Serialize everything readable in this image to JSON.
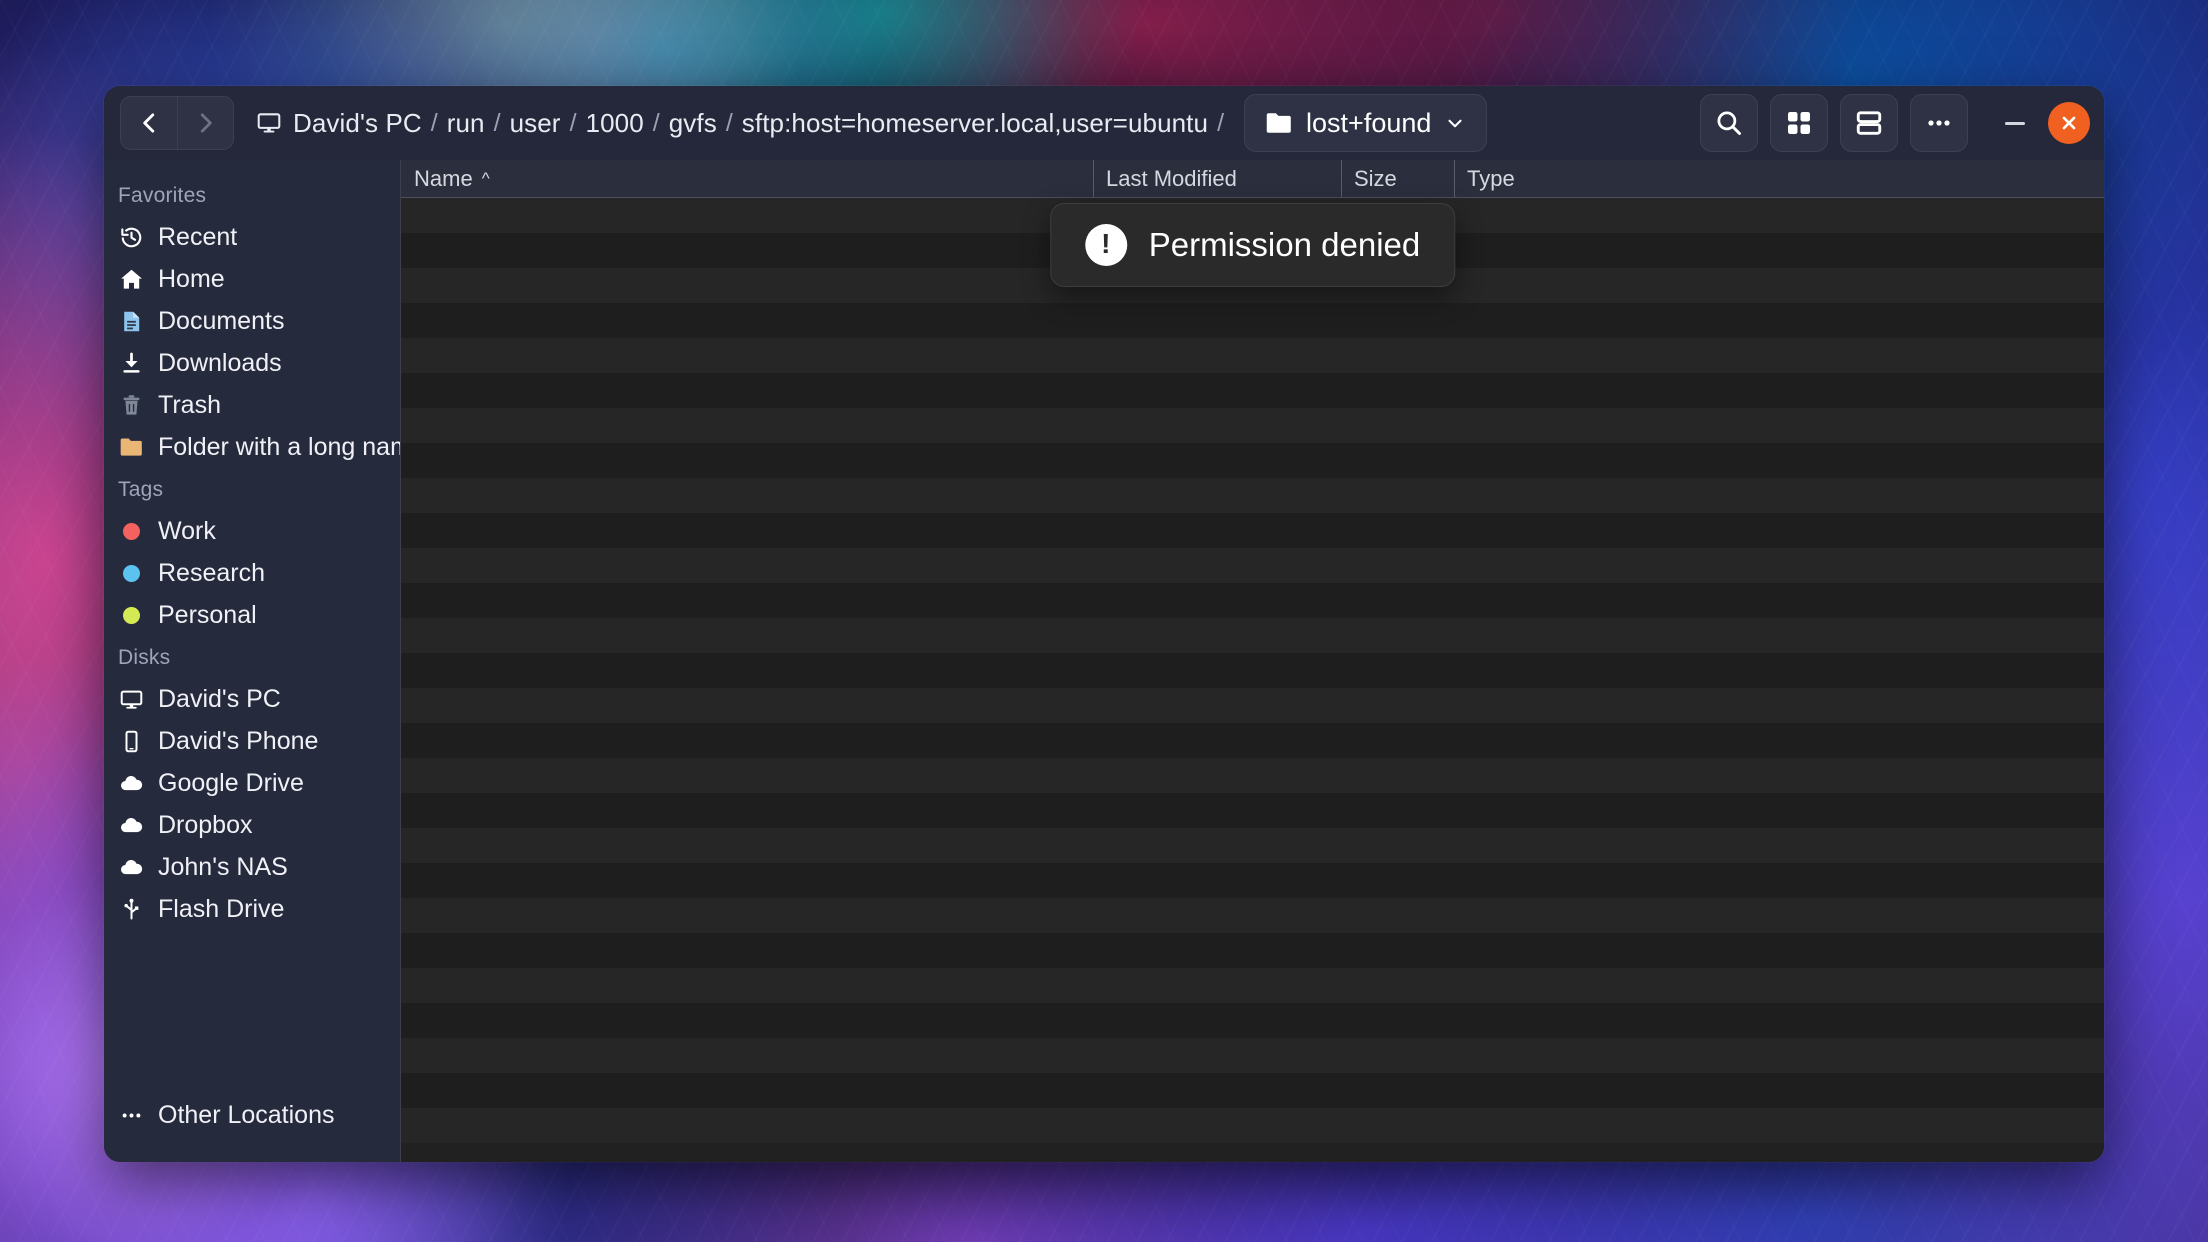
{
  "window": {
    "nav": {
      "back_icon": "chevron-left-icon",
      "forward_icon": "chevron-right-icon"
    },
    "breadcrumb": {
      "root_icon": "monitor-icon",
      "items": [
        "David's PC",
        "run",
        "user",
        "1000",
        "gvfs",
        "sftp:host=homeserver.local,user=ubuntu"
      ],
      "separator": "/"
    },
    "current_folder": {
      "icon": "folder-icon",
      "label": "lost+found",
      "chevron": "chevron-down-icon"
    },
    "toolbar": {
      "search_icon": "search-icon",
      "grid_view_icon": "grid-view-icon",
      "list_view_icon": "list-view-icon",
      "menu_icon": "ellipsis-icon"
    },
    "controls": {
      "minimize_icon": "minimize-icon",
      "close_icon": "close-icon",
      "close_color": "#f06020"
    }
  },
  "sidebar": {
    "sections": [
      {
        "header": "Favorites",
        "items": [
          {
            "label": "Recent",
            "icon": "history-clock-icon",
            "color": "#ffffff"
          },
          {
            "label": "Home",
            "icon": "home-icon",
            "color": "#ffffff"
          },
          {
            "label": "Documents",
            "icon": "document-icon",
            "color": "#8fc4ec"
          },
          {
            "label": "Downloads",
            "icon": "download-icon",
            "color": "#ffffff"
          },
          {
            "label": "Trash",
            "icon": "trash-icon",
            "color": "#7e8796"
          },
          {
            "label": "Folder with a long name",
            "icon": "folder-icon",
            "color": "#eab676"
          }
        ]
      },
      {
        "header": "Tags",
        "items": [
          {
            "label": "Work",
            "icon": "tag-dot-icon",
            "color": "#f4615e"
          },
          {
            "label": "Research",
            "icon": "tag-dot-icon",
            "color": "#5cc3f0"
          },
          {
            "label": "Personal",
            "icon": "tag-dot-icon",
            "color": "#d4ea54"
          }
        ]
      },
      {
        "header": "Disks",
        "items": [
          {
            "label": "David's PC",
            "icon": "monitor-icon",
            "color": "#ffffff"
          },
          {
            "label": "David's Phone",
            "icon": "phone-icon",
            "color": "#ffffff"
          },
          {
            "label": "Google Drive",
            "icon": "cloud-icon",
            "color": "#ffffff"
          },
          {
            "label": "Dropbox",
            "icon": "cloud-icon",
            "color": "#ffffff"
          },
          {
            "label": "John's NAS",
            "icon": "cloud-icon",
            "color": "#ffffff"
          },
          {
            "label": "Flash Drive",
            "icon": "usb-icon",
            "color": "#ffffff"
          }
        ]
      }
    ],
    "other_locations": {
      "label": "Other Locations",
      "icon": "ellipsis-icon"
    }
  },
  "file_list": {
    "columns": [
      {
        "label": "Name",
        "sorted": true,
        "sort_arrow": "^"
      },
      {
        "label": "Last Modified",
        "sorted": false
      },
      {
        "label": "Size",
        "sorted": false
      },
      {
        "label": "Type",
        "sorted": false
      }
    ],
    "rows": [],
    "empty_row_count": 27
  },
  "toast": {
    "icon": "warning-exclamation-icon",
    "exclamation": "!",
    "message": "Permission denied"
  }
}
